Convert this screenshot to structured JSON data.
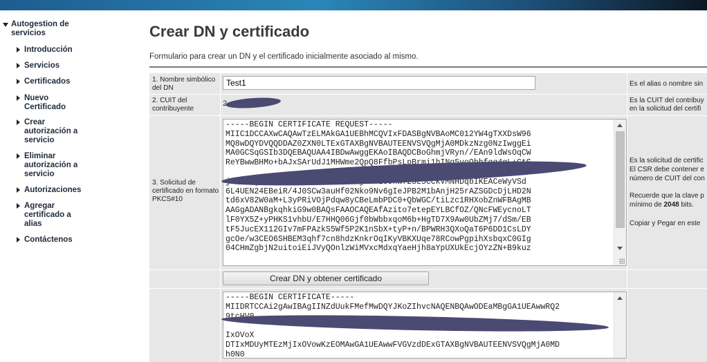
{
  "sidebar": {
    "section_title": "Autogestion de servicios",
    "items": [
      {
        "label": "Introducción"
      },
      {
        "label": "Servicios"
      },
      {
        "label": "Certificados"
      },
      {
        "label": "Nuevo Certificado"
      },
      {
        "label": "Crear autorización a servicio"
      },
      {
        "label": "Eliminar autorización a servicio"
      },
      {
        "label": "Autorizaciones"
      },
      {
        "label": "Agregar certificado a alias"
      },
      {
        "label": "Contáctenos"
      }
    ]
  },
  "page": {
    "title": "Crear DN y certificado",
    "subtitle": "Formulario para crear un DN y el certificado inicialmente asociado al mismo."
  },
  "form": {
    "alias_label": "1. Nombre simbólico del DN",
    "alias_value": "Test1",
    "alias_help": "Es el alias o nombre sin",
    "cuit_label": "2. CUIT del contribuyente",
    "cuit_value": "2",
    "cuit_help_1": "Es la CUIT del contribuy",
    "cuit_help_2": "en la solicitud del certifi",
    "csr_label": "3. Solicitud de certificado en formato PKCS#10",
    "csr_value": "-----BEGIN CERTIFICATE REQUEST-----\nMIIC1DCCAXwCAQAwTzELMAkGA1UEBhMCQVIxFDASBgNVBAoMC012YW4gTXXDsW96\nMQ8wDQYDVQQDDAZ0ZXN0LTExGTAXBgNVBAUTEENVSVQgMjA0MDkzNzg0NzIwggEi\nMA0GCSqGSIb3DQEBAQUAA4IBDwAwggEKAoIBAQDCBoGhmjVRyn//EAn9ldWsOqCW\nReYBwwBHMo+bAJxSArUdJ1MHWme2QpQ8FfbPsLpBrmi1hINg5voOhbfqq4qL+CtS\n\njaBWNGgG+203XEw9ChF100hLanC1jvtb2J9xWf23L5CCkVMNHDqbIKEACeWyVSd\n6L4UEN24EBeiR/4J0SCw3auHf02Nko9Nv6gIeJPB2M1bAnjH25rAZSGDcDjLHD2N\ntd6xV82W0aM+L3yPRiVOjPdqw8yCBeLmbPDC0+QbWGC/tiLzc1RHXobZnWFBAgMB\nAAGgADANBgkqhkiG9w0BAQsFAAOCAQEAfAzito7etepEYLBCfOZ/QNcFWEycnoLT\nlF0YX5Z+yPHKS1vhbU/E7HHQ06Gjf0bWbbxqoM6b+HgTD7X9Aw0UbZMj7/dSm/EB\ntF5JucEX112GIv7mFPAzkS5Wf5P2K1nSbX+tyP+n/BPWRH3QXoQaT6P6DD1CsLDY\ngcOe/w3CEO6SHBEM3qhf7cn8hdzKnkrOqIKyVBKXUqe78RCowPgpihXsbqxC0GIg\n04CHmZgbjN2uitoiEiJVyQOnlzWiMVxcMdxqYaeHjh8aYpUXUkEcjOYzZN+B9kuz",
    "csr_help_1": "Es la solicitud de certific",
    "csr_help_2": "El CSR debe contener e",
    "csr_help_3": "número de CUIT del con",
    "csr_help_4": "Recuerde que la clave p",
    "csr_help_5_prefix": "mínimo de ",
    "csr_help_5_bits": "2048",
    "csr_help_5_suffix": " bits.",
    "csr_help_6": "Copiar y Pegar en este",
    "submit_label": "Crear DN y obtener certificado",
    "cert_value": "-----BEGIN CERTIFICATE-----\nMIIDRTCCAi2gAwIBAgIINZdUukFMefMwDQYJKoZIhvcNAQENBQAwODEaMBgGA1UEAwwRQ2\n9tcHV0\n\nIxOVoX\nDTIxMDUyMTEzMjIxOVowKzEOMAwGA1UEAwwFVGVzdDExGTAXBgNVBAUTEENVSVQgMjA0MD\nh0N0"
  }
}
